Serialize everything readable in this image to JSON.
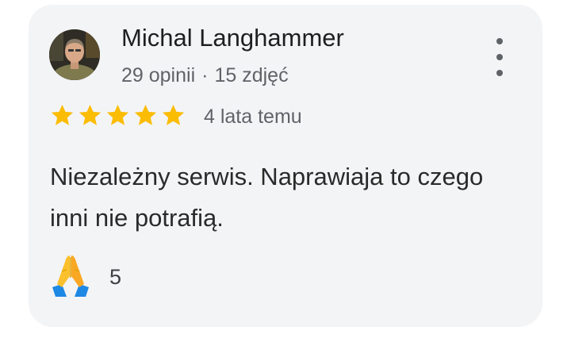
{
  "review": {
    "author_name": "Michal Langhammer",
    "reviews_count": "29 opinii",
    "separator": "·",
    "photos_count": "15 zdjęć",
    "rating": 5,
    "rating_max": 5,
    "date": "4 lata temu",
    "text": "Niezależny serwis. Naprawiaja to czego inni nie potrafią.",
    "reaction": {
      "icon": "folded-hands-icon",
      "count": "5"
    }
  },
  "colors": {
    "card_background": "#f3f4f6",
    "star": "#fbbc04",
    "name": "#1f1f1f",
    "secondary_text": "#5f6368"
  }
}
